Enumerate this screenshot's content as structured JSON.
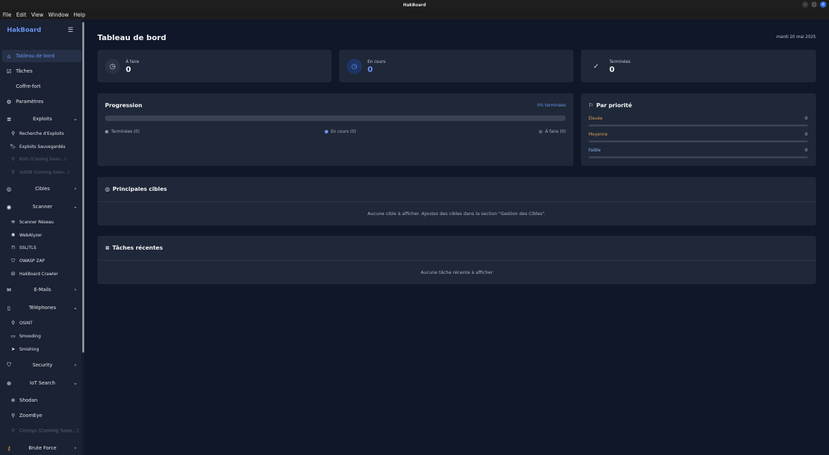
{
  "window": {
    "title": "HakBoard"
  },
  "menu": [
    "File",
    "Edit",
    "View",
    "Window",
    "Help"
  ],
  "sidebar": {
    "brand": "HakBoard",
    "items": [
      {
        "label": "Tableau de bord",
        "icon": "home-icon",
        "active": true
      },
      {
        "label": "Tâches",
        "icon": "checkbox-icon"
      },
      {
        "label": "Coffre-fort",
        "icon": "safe-icon"
      },
      {
        "label": "Paramètres",
        "icon": "gear-icon"
      }
    ],
    "groups": {
      "exploits": {
        "label": "Exploits",
        "subs": [
          "Recherche d'Exploits",
          "Exploits Sauvegardés",
          "NVD (Coming Soon...)",
          "VulDB (Coming Soon...)"
        ]
      },
      "cibles": {
        "label": "Cibles"
      },
      "scanner": {
        "label": "Scanner",
        "subs": [
          "Scanner Réseau",
          "WebAlyzer",
          "SSL/TLS",
          "OWASP ZAP",
          "HakBoard Crawler"
        ]
      },
      "emails": {
        "label": "E-Mails"
      },
      "telephones": {
        "label": "Téléphones",
        "subs": [
          "OSINT",
          "Smooding",
          "Smishing"
        ]
      },
      "security": {
        "label": "Security"
      },
      "iot": {
        "label": "IoT Search",
        "subs": [
          "Shodan",
          "ZoomEye",
          "Censys (Coming Soon...)"
        ]
      },
      "brute": {
        "label": "Brute Force"
      }
    }
  },
  "header": {
    "title": "Tableau de bord",
    "date": "mardi 20 mai 2025"
  },
  "stats": [
    {
      "label": "À faire",
      "value": "0"
    },
    {
      "label": "En cours",
      "value": "0"
    },
    {
      "label": "Terminées",
      "value": "0"
    }
  ],
  "progress": {
    "title": "Progression",
    "pct_label": "0% terminées",
    "pct": 0,
    "legend": [
      "Terminées (0)",
      "En cours (0)",
      "À faire (0)"
    ]
  },
  "priority": {
    "title": "Par priorité",
    "rows": [
      {
        "label": "Élevée",
        "value": "0",
        "color": "#e0a050"
      },
      {
        "label": "Moyenne",
        "value": "0",
        "color": "#e0a050"
      },
      {
        "label": "Faible",
        "value": "0",
        "color": "#8fb4f5"
      }
    ]
  },
  "targets": {
    "title": "Principales cibles",
    "empty": "Aucune cible à afficher. Ajoutez des cibles dans la section \"Gestion des Cibles\"."
  },
  "recent": {
    "title": "Tâches récentes",
    "empty": "Aucune tâche récente à afficher"
  },
  "colors": {
    "accent": "#6b94f0",
    "bg": "#0f1729",
    "card": "#1f2838"
  }
}
